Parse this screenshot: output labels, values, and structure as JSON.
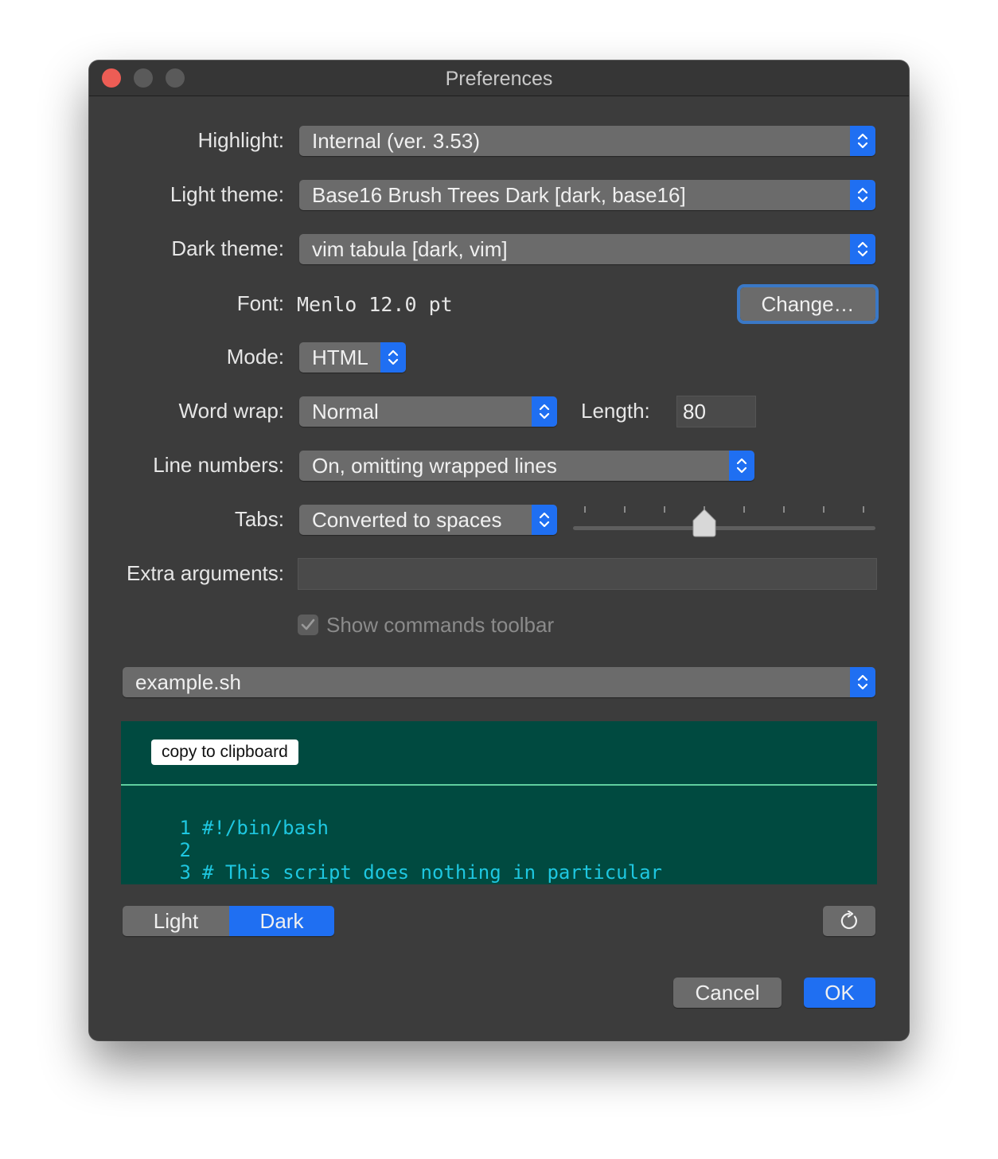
{
  "window": {
    "title": "Preferences"
  },
  "form": {
    "highlight": {
      "label": "Highlight:",
      "value": "Internal (ver. 3.53)"
    },
    "light_theme": {
      "label": "Light theme:",
      "value": "Base16 Brush Trees Dark [dark, base16]"
    },
    "dark_theme": {
      "label": "Dark theme:",
      "value": "vim tabula [dark, vim]"
    },
    "font": {
      "label": "Font:",
      "value": "Menlo 12.0 pt",
      "change_button": "Change…"
    },
    "mode": {
      "label": "Mode:",
      "value": "HTML"
    },
    "word_wrap": {
      "label": "Word wrap:",
      "value": "Normal",
      "length_label": "Length:",
      "length_value": "80"
    },
    "line_numbers": {
      "label": "Line numbers:",
      "value": "On, omitting wrapped lines"
    },
    "tabs": {
      "label": "Tabs:",
      "value": "Converted to spaces",
      "slider_fraction": 0.43
    },
    "extra_arguments": {
      "label": "Extra arguments:",
      "value": ""
    },
    "show_toolbar": {
      "label": "Show commands toolbar",
      "checked": true,
      "enabled": false
    }
  },
  "example": {
    "file": "example.sh",
    "copy_button": "copy to clipboard",
    "lines": [
      {
        "number": "1",
        "text": "#!/bin/bash"
      },
      {
        "number": "2",
        "text": ""
      },
      {
        "number": "3",
        "text": "# This script does nothing in particular"
      }
    ]
  },
  "appearance": {
    "light": "Light",
    "dark": "Dark",
    "selected": "Dark"
  },
  "footer": {
    "cancel": "Cancel",
    "ok": "OK"
  },
  "colors": {
    "accent": "#1f6ff2",
    "window_bg": "#3c3c3c",
    "preview_bg": "#004a40",
    "code_text": "#1ec7e0"
  }
}
